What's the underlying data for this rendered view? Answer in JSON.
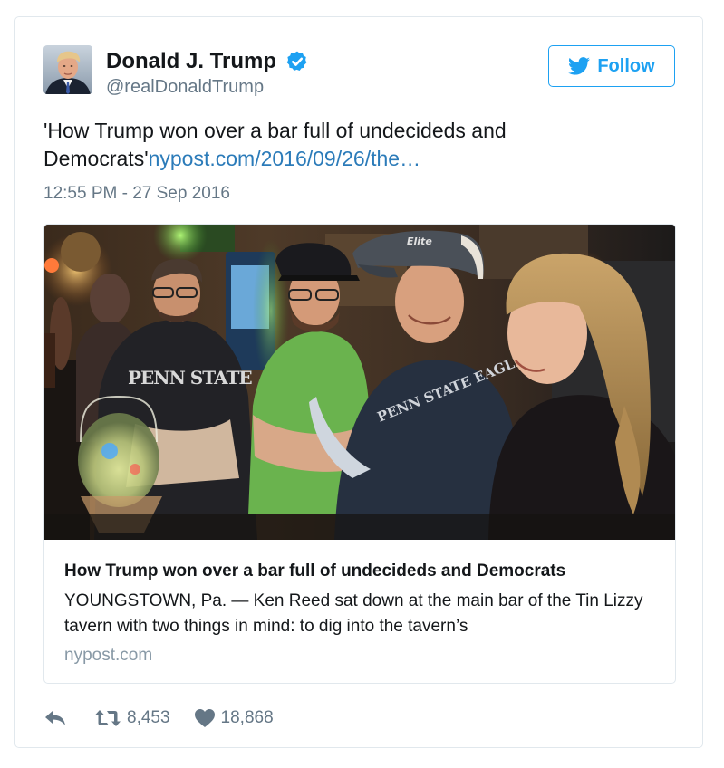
{
  "author": {
    "name": "Donald J. Trump",
    "handle": "@realDonaldTrump"
  },
  "follow_button": {
    "label": "Follow"
  },
  "tweet": {
    "text": "'How Trump won over a bar full of undecideds and Democrats'",
    "link": "nypost.com/2016/09/26/the…",
    "timestamp": "12:55 PM - 27 Sep 2016"
  },
  "card": {
    "title": "How Trump won over a bar full of undecideds and Democrats",
    "description": "YOUNGSTOWN, Pa. — Ken Reed sat down at the main bar of the Tin Lizzy tavern with two things in mind: to dig into the tavern’s",
    "domain": "nypost.com",
    "image_text": {
      "shirt_left": "PENN STATE",
      "shirt_center": "PENN STATE EAGLES"
    }
  },
  "actions": {
    "retweets": "8,453",
    "likes": "18,868"
  },
  "colors": {
    "accent": "#1da1f2",
    "link": "#2b7bb9",
    "muted": "#657786",
    "text": "#14171a"
  },
  "icons": [
    "verified-badge-icon",
    "twitter-bird-icon",
    "reply-icon",
    "retweet-icon",
    "heart-icon"
  ]
}
